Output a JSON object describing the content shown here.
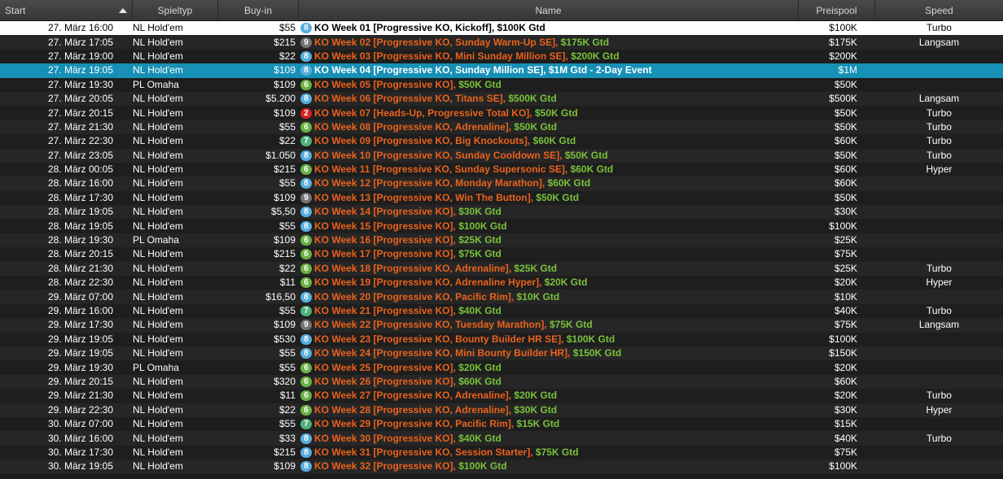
{
  "columns": {
    "start": "Start",
    "type": "Spieltyp",
    "buyin": "Buy-in",
    "name": "Name",
    "pool": "Preispool",
    "speed": "Speed"
  },
  "colors": {
    "name_orange": "#e9621c",
    "gtd_green": "#79c23a",
    "selected_row": "#1790b6",
    "badge_8": "#58aedf",
    "badge_6": "#6ab244",
    "badge_7": "#4fb079",
    "badge_9": "#747474",
    "badge_2": "#d52323"
  },
  "rows": [
    {
      "start": "27. März  16:00",
      "type": "NL Hold'em",
      "buyin": "$55",
      "badge": "8",
      "name": "KO Week 01 [Progressive KO, Kickoff],",
      "gtd": "$100K Gtd",
      "pool": "$100K",
      "speed": "Turbo",
      "state": "first"
    },
    {
      "start": "27. März  17:05",
      "type": "NL Hold'em",
      "buyin": "$215",
      "badge": "9",
      "name": "KO Week 02 [Progressive KO, Sunday Warm-Up SE],",
      "gtd": "$175K Gtd",
      "pool": "$175K",
      "speed": "Langsam"
    },
    {
      "start": "27. März  19:00",
      "type": "NL Hold'em",
      "buyin": "$22",
      "badge": "8",
      "name": "KO Week 03 [Progressive KO, Mini Sunday Million SE],",
      "gtd": "$200K Gtd",
      "pool": "$200K",
      "speed": ""
    },
    {
      "start": "27. März  19:05",
      "type": "NL Hold'em",
      "buyin": "$109",
      "badge": "8",
      "name": "KO Week 04 [Progressive KO, Sunday Million SE],",
      "gtd": "$1M Gtd - 2-Day Event",
      "pool": "$1M",
      "speed": "",
      "state": "selected"
    },
    {
      "start": "27. März  19:30",
      "type": "PL Omaha",
      "buyin": "$109",
      "badge": "6",
      "name": "KO Week 05 [Progressive KO],",
      "gtd": "$50K Gtd",
      "pool": "$50K",
      "speed": ""
    },
    {
      "start": "27. März  20:05",
      "type": "NL Hold'em",
      "buyin": "$5.200",
      "badge": "8",
      "name": "KO Week 06 [Progressive KO, Titans SE],",
      "gtd": "$500K Gtd",
      "pool": "$500K",
      "speed": "Langsam"
    },
    {
      "start": "27. März  20:15",
      "type": "NL Hold'em",
      "buyin": "$109",
      "badge": "2",
      "name": "KO Week 07 [Heads-Up, Progressive Total KO],",
      "gtd": "$50K Gtd",
      "pool": "$50K",
      "speed": "Turbo"
    },
    {
      "start": "27. März  21:30",
      "type": "NL Hold'em",
      "buyin": "$55",
      "badge": "6",
      "name": "KO Week 08 [Progressive KO, Adrenaline],",
      "gtd": "$50K Gtd",
      "pool": "$50K",
      "speed": "Turbo"
    },
    {
      "start": "27. März  22:30",
      "type": "NL Hold'em",
      "buyin": "$22",
      "badge": "7",
      "name": "KO Week 09 [Progressive KO, Big Knockouts],",
      "gtd": "$60K Gtd",
      "pool": "$60K",
      "speed": "Turbo"
    },
    {
      "start": "27. März  23:05",
      "type": "NL Hold'em",
      "buyin": "$1.050",
      "badge": "8",
      "name": "KO Week 10 [Progressive KO, Sunday Cooldown SE],",
      "gtd": "$50K Gtd",
      "pool": "$50K",
      "speed": "Turbo"
    },
    {
      "start": "28. März  00:05",
      "type": "NL Hold'em",
      "buyin": "$215",
      "badge": "6",
      "name": "KO Week 11 [Progressive KO, Sunday Supersonic SE],",
      "gtd": "$60K Gtd",
      "pool": "$60K",
      "speed": "Hyper"
    },
    {
      "start": "28. März  16:00",
      "type": "NL Hold'em",
      "buyin": "$55",
      "badge": "8",
      "name": "KO Week 12 [Progressive KO, Monday Marathon],",
      "gtd": "$60K Gtd",
      "pool": "$60K",
      "speed": ""
    },
    {
      "start": "28. März  17:30",
      "type": "NL Hold'em",
      "buyin": "$109",
      "badge": "9",
      "name": "KO Week 13 [Progressive KO, Win The Button],",
      "gtd": "$50K Gtd",
      "pool": "$50K",
      "speed": ""
    },
    {
      "start": "28. März  19:05",
      "type": "NL Hold'em",
      "buyin": "$5,50",
      "badge": "8",
      "name": "KO Week 14 [Progressive KO],",
      "gtd": "$30K Gtd",
      "pool": "$30K",
      "speed": ""
    },
    {
      "start": "28. März  19:05",
      "type": "NL Hold'em",
      "buyin": "$55",
      "badge": "8",
      "name": "KO Week 15 [Progressive KO],",
      "gtd": "$100K Gtd",
      "pool": "$100K",
      "speed": ""
    },
    {
      "start": "28. März  19:30",
      "type": "PL Omaha",
      "buyin": "$109",
      "badge": "6",
      "name": "KO Week 16 [Progressive KO],",
      "gtd": "$25K Gtd",
      "pool": "$25K",
      "speed": ""
    },
    {
      "start": "28. März  20:15",
      "type": "NL Hold'em",
      "buyin": "$215",
      "badge": "6",
      "name": "KO Week 17 [Progressive KO],",
      "gtd": "$75K Gtd",
      "pool": "$75K",
      "speed": ""
    },
    {
      "start": "28. März  21:30",
      "type": "NL Hold'em",
      "buyin": "$22",
      "badge": "6",
      "name": "KO Week 18 [Progressive KO, Adrenaline],",
      "gtd": "$25K Gtd",
      "pool": "$25K",
      "speed": "Turbo"
    },
    {
      "start": "28. März  22:30",
      "type": "NL Hold'em",
      "buyin": "$11",
      "badge": "6",
      "name": "KO Week 19 [Progressive KO, Adrenaline Hyper],",
      "gtd": "$20K Gtd",
      "pool": "$20K",
      "speed": "Hyper"
    },
    {
      "start": "29. März  07:00",
      "type": "NL Hold'em",
      "buyin": "$16,50",
      "badge": "8",
      "name": "KO Week 20 [Progressive KO, Pacific Rim],",
      "gtd": "$10K Gtd",
      "pool": "$10K",
      "speed": ""
    },
    {
      "start": "29. März  16:00",
      "type": "NL Hold'em",
      "buyin": "$55",
      "badge": "7",
      "name": "KO Week 21 [Progressive KO],",
      "gtd": "$40K Gtd",
      "pool": "$40K",
      "speed": "Turbo"
    },
    {
      "start": "29. März  17:30",
      "type": "NL Hold'em",
      "buyin": "$109",
      "badge": "9",
      "name": "KO Week 22 [Progressive KO, Tuesday Marathon],",
      "gtd": "$75K Gtd",
      "pool": "$75K",
      "speed": "Langsam"
    },
    {
      "start": "29. März  19:05",
      "type": "NL Hold'em",
      "buyin": "$530",
      "badge": "8",
      "name": "KO Week 23 [Progressive KO, Bounty Builder HR SE],",
      "gtd": "$100K Gtd",
      "pool": "$100K",
      "speed": ""
    },
    {
      "start": "29. März  19:05",
      "type": "NL Hold'em",
      "buyin": "$55",
      "badge": "8",
      "name": "KO Week 24 [Progressive KO, Mini Bounty Builder HR],",
      "gtd": "$150K Gtd",
      "pool": "$150K",
      "speed": ""
    },
    {
      "start": "29. März  19:30",
      "type": "PL Omaha",
      "buyin": "$55",
      "badge": "6",
      "name": "KO Week 25 [Progressive KO],",
      "gtd": "$20K Gtd",
      "pool": "$20K",
      "speed": ""
    },
    {
      "start": "29. März  20:15",
      "type": "NL Hold'em",
      "buyin": "$320",
      "badge": "6",
      "name": "KO Week 26 [Progressive KO],",
      "gtd": "$60K Gtd",
      "pool": "$60K",
      "speed": ""
    },
    {
      "start": "29. März  21:30",
      "type": "NL Hold'em",
      "buyin": "$11",
      "badge": "6",
      "name": "KO Week 27 [Progressive KO, Adrenaline],",
      "gtd": "$20K Gtd",
      "pool": "$20K",
      "speed": "Turbo"
    },
    {
      "start": "29. März  22:30",
      "type": "NL Hold'em",
      "buyin": "$22",
      "badge": "6",
      "name": "KO Week 28 [Progressive KO, Adrenaline],",
      "gtd": "$30K Gtd",
      "pool": "$30K",
      "speed": "Hyper"
    },
    {
      "start": "30. März  07:00",
      "type": "NL Hold'em",
      "buyin": "$55",
      "badge": "7",
      "name": "KO Week 29 [Progressive KO, Pacific Rim],",
      "gtd": "$15K Gtd",
      "pool": "$15K",
      "speed": ""
    },
    {
      "start": "30. März  16:00",
      "type": "NL Hold'em",
      "buyin": "$33",
      "badge": "8",
      "name": "KO Week 30 [Progressive KO],",
      "gtd": "$40K Gtd",
      "pool": "$40K",
      "speed": "Turbo"
    },
    {
      "start": "30. März  17:30",
      "type": "NL Hold'em",
      "buyin": "$215",
      "badge": "8",
      "name": "KO Week 31 [Progressive KO, Session Starter],",
      "gtd": "$75K Gtd",
      "pool": "$75K",
      "speed": ""
    },
    {
      "start": "30. März  19:05",
      "type": "NL Hold'em",
      "buyin": "$109",
      "badge": "8",
      "name": "KO Week 32 [Progressive KO],",
      "gtd": "$100K Gtd",
      "pool": "$100K",
      "speed": ""
    }
  ]
}
